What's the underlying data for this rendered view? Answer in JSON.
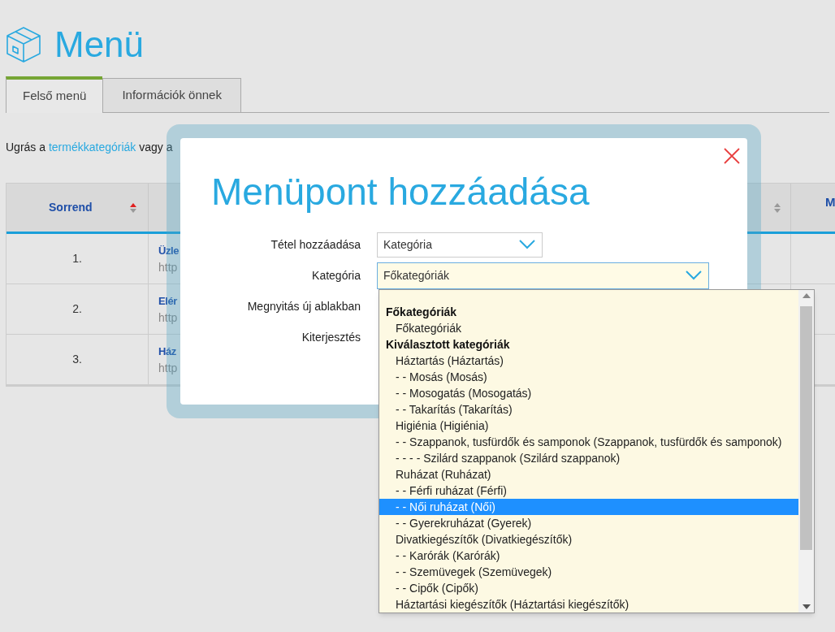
{
  "page": {
    "title": "Menü"
  },
  "tabs": [
    {
      "label": "Felső menü",
      "selected": true
    },
    {
      "label": "Információk önnek",
      "selected": false
    }
  ],
  "intro": {
    "before": "Ugrás a",
    "link": "termékkategóriák",
    "after": "vagy a"
  },
  "table": {
    "columns": [
      {
        "label": "Sorrend",
        "sorted": true
      },
      {
        "sorted": false
      },
      {
        "label": "M"
      }
    ],
    "rows": [
      {
        "order": "1.",
        "title": "Üzle",
        "url": "http"
      },
      {
        "order": "2.",
        "title": "Elér",
        "url": "http"
      },
      {
        "order": "3.",
        "title": "Ház",
        "url": "http"
      }
    ]
  },
  "modal": {
    "title": "Menüpont hozzáadása",
    "fields": [
      {
        "label": "Tétel hozzáadása",
        "kind": "select",
        "value": "Kategória",
        "focused": false
      },
      {
        "label": "Kategória",
        "kind": "select",
        "value": "Főkategóriák",
        "focused": true
      },
      {
        "label": "Megnyitás új ablakban",
        "kind": "label"
      },
      {
        "label": "Kiterjesztés",
        "kind": "label"
      }
    ]
  },
  "dropdown": {
    "groups": [
      {
        "label": "Főkategóriák",
        "options": [
          {
            "label": "Főkategóriák",
            "selected": false
          }
        ]
      },
      {
        "label": "Kiválasztott kategóriák",
        "options": [
          {
            "label": "Háztartás (Háztartás)",
            "selected": false
          },
          {
            "label": "- - Mosás (Mosás)",
            "selected": false
          },
          {
            "label": "- - Mosogatás (Mosogatás)",
            "selected": false
          },
          {
            "label": "- - Takarítás (Takarítás)",
            "selected": false
          },
          {
            "label": "Higiénia (Higiénia)",
            "selected": false
          },
          {
            "label": "- - Szappanok, tusfürdők és samponok (Szappanok, tusfürdők és samponok)",
            "selected": false
          },
          {
            "label": "- - - - Szilárd szappanok (Szilárd szappanok)",
            "selected": false
          },
          {
            "label": "Ruházat (Ruházat)",
            "selected": false
          },
          {
            "label": "- - Férfi ruházat (Férfi)",
            "selected": false
          },
          {
            "label": "- - Női ruházat (Női)",
            "selected": true
          },
          {
            "label": "- - Gyerekruházat (Gyerek)",
            "selected": false
          },
          {
            "label": "Divatkiegészítők (Divatkiegészítők)",
            "selected": false
          },
          {
            "label": "- - Karórák (Karórák)",
            "selected": false
          },
          {
            "label": "- - Szemüvegek (Szemüvegek)",
            "selected": false
          },
          {
            "label": "- - Cipők (Cipők)",
            "selected": false
          },
          {
            "label": "Háztartási kiegészítők (Háztartási kiegészítők)",
            "selected": false
          }
        ]
      }
    ]
  }
}
